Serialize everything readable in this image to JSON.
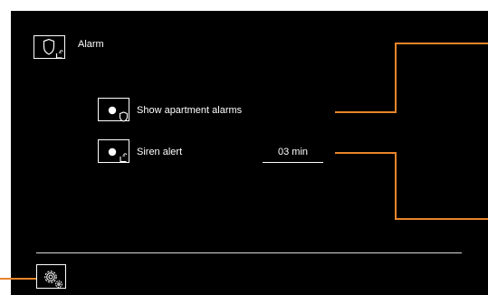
{
  "header": {
    "title": "Alarm",
    "icon": "shield-phone-icon"
  },
  "settings": [
    {
      "label": "Show apartment alarms",
      "icon": "toggle-shield-icon"
    },
    {
      "label": "Siren alert",
      "icon": "toggle-phone-icon",
      "value": "03 min"
    }
  ],
  "footer": {
    "icon": "gear-settings-icon"
  },
  "colors": {
    "background": "#000000",
    "foreground": "#ffffff",
    "callout": "#e8852b"
  }
}
